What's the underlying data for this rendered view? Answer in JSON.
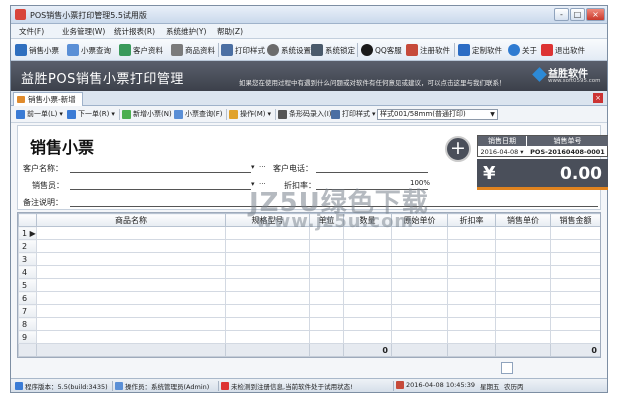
{
  "window": {
    "title": "POS销售小票打印管理5.5试用版",
    "controls": [
      "-",
      "□",
      "×"
    ]
  },
  "menu": [
    "文件(F)",
    "业务管理(W)",
    "统计报表(R)",
    "系统维护(Y)",
    "帮助(Z)"
  ],
  "toolbar": [
    {
      "label": "销售小票",
      "icon": "receipt-icon",
      "color": "#2f6fbf"
    },
    {
      "label": "小票查询",
      "icon": "search-receipt-icon",
      "color": "#5a8fd6"
    },
    {
      "label": "客户资料",
      "icon": "customers-icon",
      "color": "#3a9a5b"
    },
    {
      "label": "商品资料",
      "icon": "products-icon",
      "color": "#7b7b7b"
    },
    {
      "label": "打印样式",
      "icon": "print-style-icon",
      "color": "#4b6fa3"
    },
    {
      "label": "系统设置",
      "icon": "settings-icon",
      "color": "#6b6b6b"
    },
    {
      "label": "系统锁定",
      "icon": "lock-icon",
      "color": "#4a5a6b"
    },
    {
      "label": "QQ客服",
      "icon": "qq-icon",
      "color": "#1a1a1a"
    },
    {
      "label": "注册软件",
      "icon": "register-icon",
      "color": "#c64a3a"
    },
    {
      "label": "定制软件",
      "icon": "custom-icon",
      "color": "#2b6cc4"
    },
    {
      "label": "关于",
      "icon": "info-icon",
      "color": "#2f7bd1"
    },
    {
      "label": "退出软件",
      "icon": "exit-icon",
      "color": "#d33"
    }
  ],
  "banner": {
    "title": "益胜POS销售小票打印管理",
    "notice": "如果您在使用过程中有遇到什么问题或对软件有任何意见或建议，可以点击这里与我们联系！",
    "logo_text": "益胜软件",
    "logo_url": "www.soft0595.com"
  },
  "tab": {
    "label": "销售小票-新增"
  },
  "subtoolbar": {
    "prev": "前一单(L)",
    "next": "下一单(R)",
    "new": "新增小票(N)",
    "query": "小票查询(F)",
    "operate": "操作(M)",
    "barcode": "条形码录入(I)",
    "print_style": "打印样式",
    "style_value": "样式001/58mm(普通打印)"
  },
  "form": {
    "title": "销售小票",
    "customer_name_label": "客户名称：",
    "customer_phone_label": "客户电话：",
    "salesperson_label": "销售员：",
    "discount_label": "折扣率：",
    "discount_value": "100%",
    "remark_label": "备注说明：",
    "date_header": "销售日期",
    "date_value": "2016-04-08",
    "order_header": "销售单号",
    "order_value": "POS-20160408-0001",
    "currency_symbol": "¥",
    "total": "0.00"
  },
  "grid": {
    "columns": [
      "",
      "商品名称",
      "规格型号",
      "单位",
      "数量",
      "原始单价",
      "折扣率",
      "销售单价",
      "销售金额"
    ],
    "rows": [
      "1",
      "2",
      "3",
      "4",
      "5",
      "6",
      "7",
      "8",
      "9"
    ],
    "current_row_marker": "▶",
    "sum_quantity": "0",
    "sum_amount": "0"
  },
  "status": {
    "version": "程序版本：5.5(build:3435)",
    "operator": "操作员：系统管理员(Admin)",
    "message": "未检测到注册信息,当前软件处于试用状态!",
    "datetime": "2016-04-08 10:45:39",
    "weekday": "星期五",
    "lunar": "农历丙"
  },
  "watermark": {
    "line1": "JZ5U绿色下载",
    "line2": "www.jz5u.com"
  }
}
